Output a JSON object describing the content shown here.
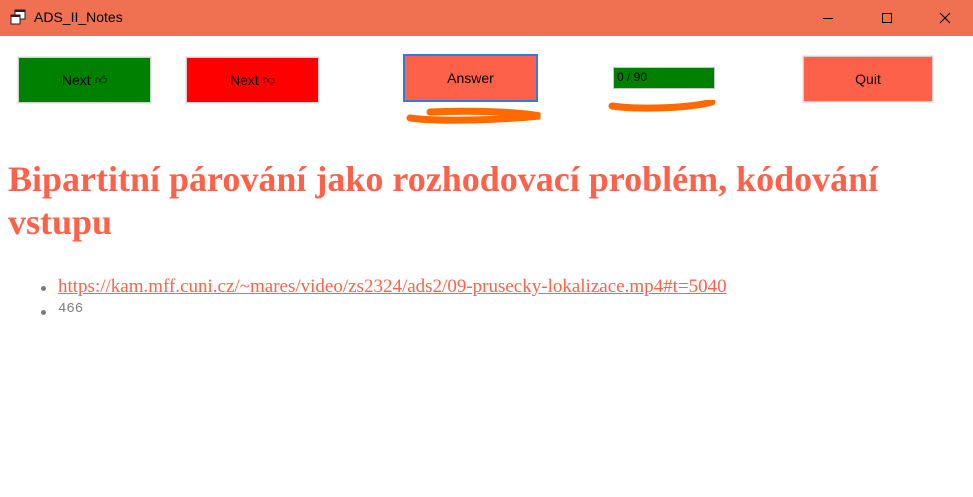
{
  "colors": {
    "titlebar": "#f07052",
    "accent": "#fe614a",
    "next_up_bg": "#008000",
    "next_down_bg": "#ff0000",
    "answer_bg": "#fe614a",
    "quit_bg": "#fe614a",
    "progress_fill": "#008000",
    "scribble": "#ff6a00"
  },
  "window": {
    "title": "ADS_II_Notes",
    "icon": "app-window-icon",
    "controls": [
      "minimize-icon",
      "maximize-icon",
      "close-icon"
    ]
  },
  "toolbar": {
    "next_up_label": "Next",
    "next_up_icon": "thumbs-up-icon",
    "next_down_label": "Next",
    "next_down_icon": "thumbs-down-icon",
    "answer_label": "Answer",
    "progress_text": "0 / 90",
    "progress_fraction": 1.0,
    "quit_label": "Quit"
  },
  "content": {
    "heading": "Bipartitní párování jako rozhodovací problém, kódování vstupu",
    "items": [
      "https://kam.mff.cuni.cz/~mares/video/zs2324/ads2/09-prusecky-lokalizace.mp4#t=5040",
      "466"
    ]
  }
}
